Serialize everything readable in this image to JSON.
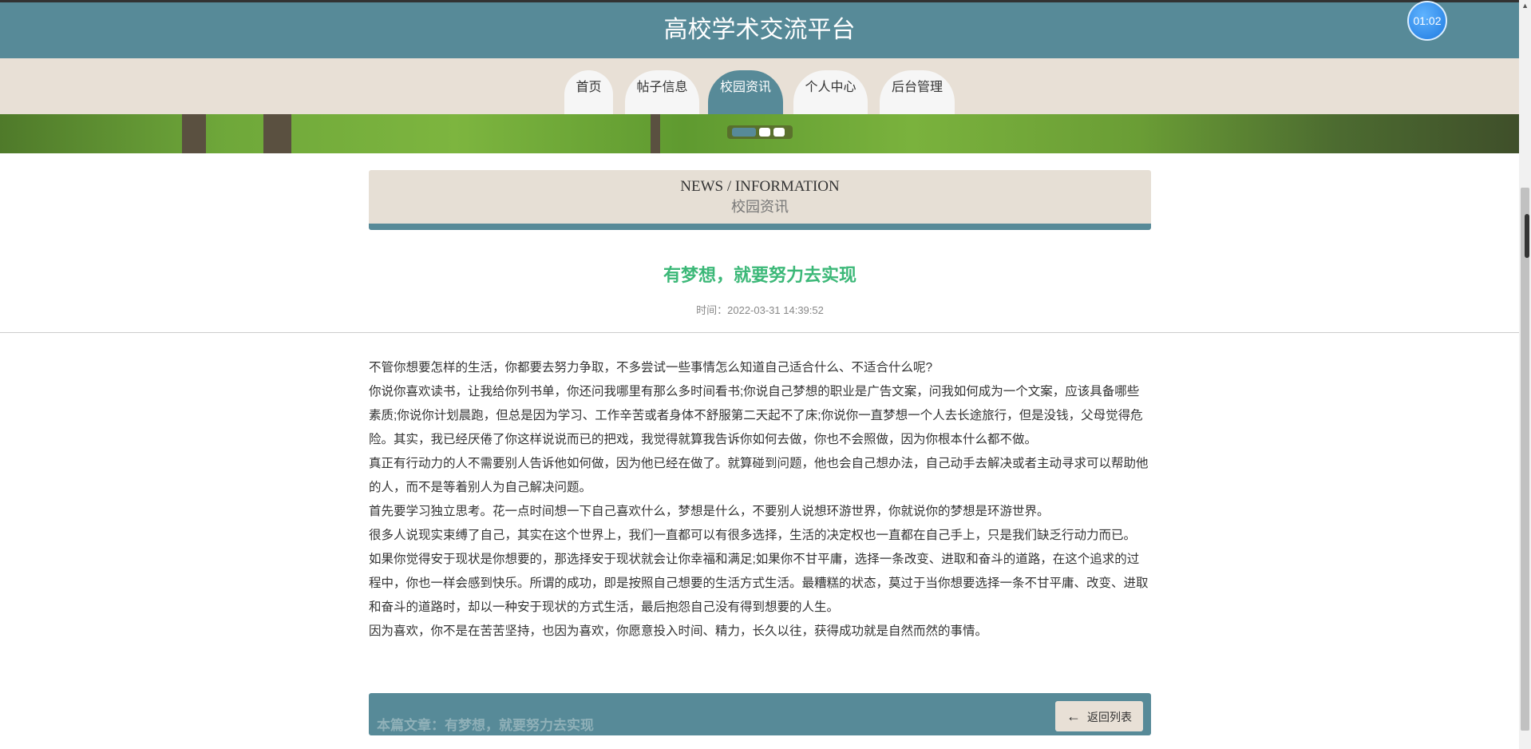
{
  "header": {
    "title": "高校学术交流平台",
    "timer": "01:02"
  },
  "nav": {
    "tabs": [
      {
        "label": "首页"
      },
      {
        "label": "帖子信息"
      },
      {
        "label": "校园资讯",
        "active": true
      },
      {
        "label": "个人中心"
      },
      {
        "label": "后台管理"
      }
    ]
  },
  "carousel": {
    "slide_count": 3,
    "active_index": 0
  },
  "section": {
    "en": "NEWS / INFORMATION",
    "cn": "校园资讯"
  },
  "article": {
    "title": "有梦想，就要努力去实现",
    "time": "时间：2022-03-31 14:39:52",
    "paragraphs": [
      "不管你想要怎样的生活，你都要去努力争取，不多尝试一些事情怎么知道自己适合什么、不适合什么呢?",
      "你说你喜欢读书，让我给你列书单，你还问我哪里有那么多时间看书;你说自己梦想的职业是广告文案，问我如何成为一个文案，应该具备哪些素质;你说你计划晨跑，但总是因为学习、工作辛苦或者身体不舒服第二天起不了床;你说你一直梦想一个人去长途旅行，但是没钱，父母觉得危险。其实，我已经厌倦了你这样说说而已的把戏，我觉得就算我告诉你如何去做，你也不会照做，因为你根本什么都不做。",
      "真正有行动力的人不需要别人告诉他如何做，因为他已经在做了。就算碰到问题，他也会自己想办法，自己动手去解决或者主动寻求可以帮助他的人，而不是等着别人为自己解决问题。",
      "首先要学习独立思考。花一点时间想一下自己喜欢什么，梦想是什么，不要别人说想环游世界，你就说你的梦想是环游世界。",
      "很多人说现实束缚了自己，其实在这个世界上，我们一直都可以有很多选择，生活的决定权也一直都在自己手上，只是我们缺乏行动力而已。",
      "如果你觉得安于现状是你想要的，那选择安于现状就会让你幸福和满足;如果你不甘平庸，选择一条改变、进取和奋斗的道路，在这个追求的过程中，你也一样会感到快乐。所谓的成功，即是按照自己想要的生活方式生活。最糟糕的状态，莫过于当你想要选择一条不甘平庸、改变、进取和奋斗的道路时，却以一种安于现状的方式生活，最后抱怨自己没有得到想要的人生。",
      "因为喜欢，你不是在苦苦坚持，也因为喜欢，你愿意投入时间、精力，长久以往，获得成功就是自然而然的事情。"
    ]
  },
  "footer": {
    "current": "本篇文章：有梦想，就要努力去实现",
    "back_label": "返回列表"
  }
}
